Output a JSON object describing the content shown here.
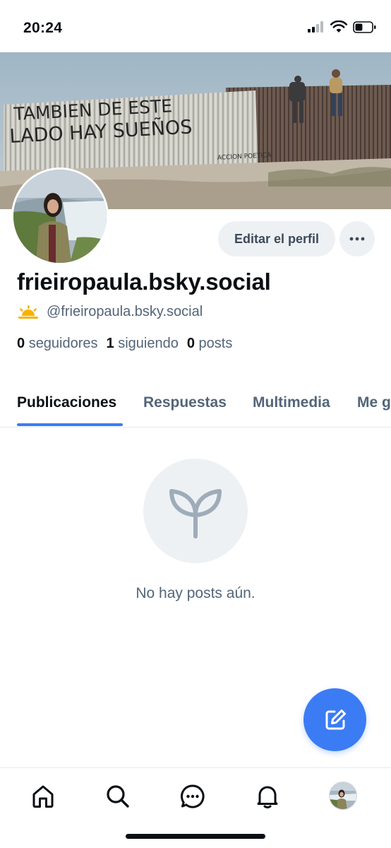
{
  "status_bar": {
    "time": "20:24",
    "battery_level": 0.45
  },
  "banner": {
    "wall_text_line1": "TAMBIEN DE ESTE",
    "wall_text_line2": "LADO HAY SUEÑOS",
    "signature_text": "ACCION POETICA"
  },
  "actions": {
    "edit_profile_label": "Editar el perfil",
    "more_label": "···"
  },
  "profile": {
    "display_name": "frieiropaula.bsky.social",
    "status_emoji": "sunrise-icon",
    "handle": "@frieiropaula.bsky.social",
    "followers_count": "0",
    "followers_label": "seguidores",
    "following_count": "1",
    "following_label": "siguiendo",
    "posts_count": "0",
    "posts_label": "posts"
  },
  "tabs": [
    {
      "label": "Publicaciones",
      "active": true
    },
    {
      "label": "Respuestas",
      "active": false
    },
    {
      "label": "Multimedia",
      "active": false
    },
    {
      "label": "Me g",
      "active": false
    }
  ],
  "empty_state": {
    "icon": "sprout-icon",
    "text": "No hay posts aún."
  },
  "fab": {
    "icon": "compose-icon"
  },
  "nav": [
    {
      "icon": "home-icon"
    },
    {
      "icon": "search-icon"
    },
    {
      "icon": "chat-icon"
    },
    {
      "icon": "bell-icon"
    },
    {
      "icon": "profile-avatar"
    }
  ],
  "colors": {
    "accent": "#3b7cf4",
    "muted_text": "#536579",
    "chip_bg": "#eef1f4",
    "emoji_yellow": "#f5b301"
  }
}
